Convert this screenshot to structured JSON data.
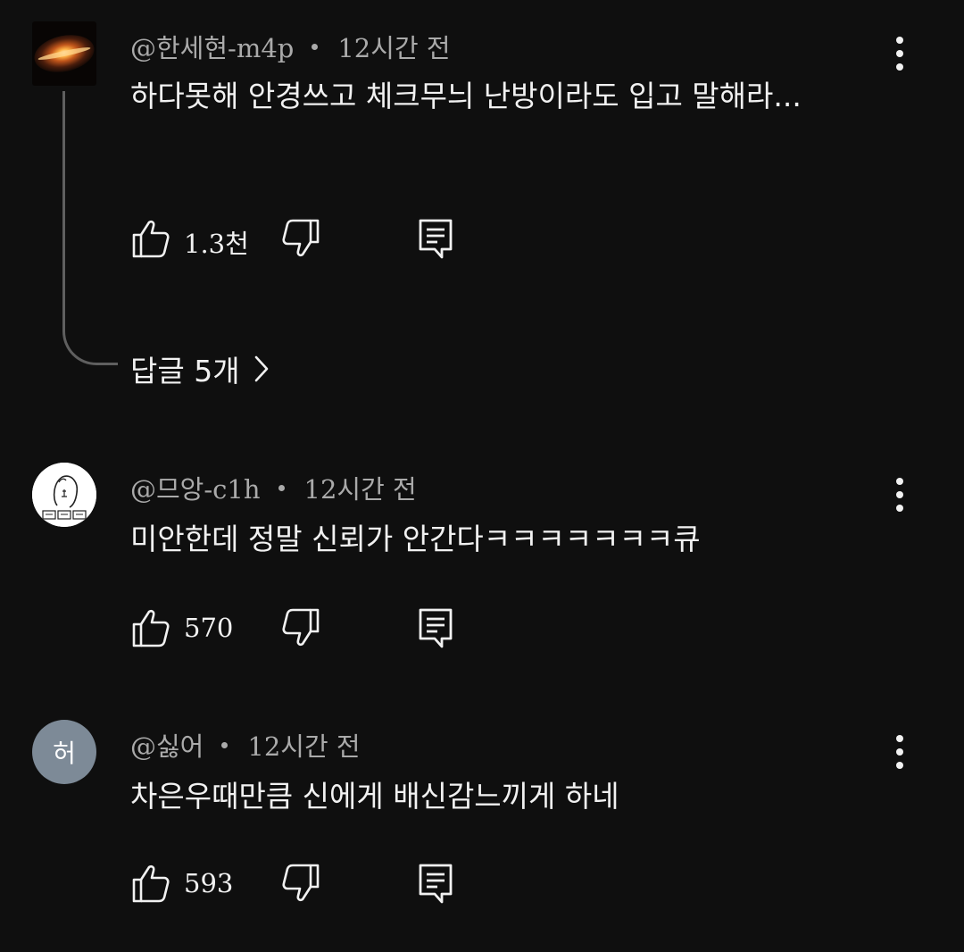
{
  "comments": [
    {
      "author": "@한세현-m4p",
      "time": "12시간 전",
      "text": "하다못해 안경쓰고 체크무늬 난방이라도 입고 말해라...",
      "likes": "1.3천",
      "avatar": "galaxy-image",
      "replies_label": "답글 5개"
    },
    {
      "author": "@므앙-c1h",
      "time": "12시간 전",
      "text": "미안한데 정말 신뢰가 안간다ㅋㅋㅋㅋㅋㅋㅋ큐",
      "likes": "570",
      "avatar": "sketch-drawing"
    },
    {
      "author": "@싫어",
      "time": "12시간 전",
      "text": "차은우때만큼 신에게 배신감느끼게 하네",
      "likes": "593",
      "avatar_letter": "허",
      "avatar_color": "#7d8a97"
    }
  ],
  "icons": {
    "like": "thumbs-up-icon",
    "dislike": "thumbs-down-icon",
    "reply": "reply-comment-icon",
    "more": "more-vertical-icon",
    "expand": "chevron-right-icon"
  },
  "colors": {
    "background": "#0f0f0f",
    "text": "#f1f1f1",
    "meta": "#aaaaaa"
  }
}
